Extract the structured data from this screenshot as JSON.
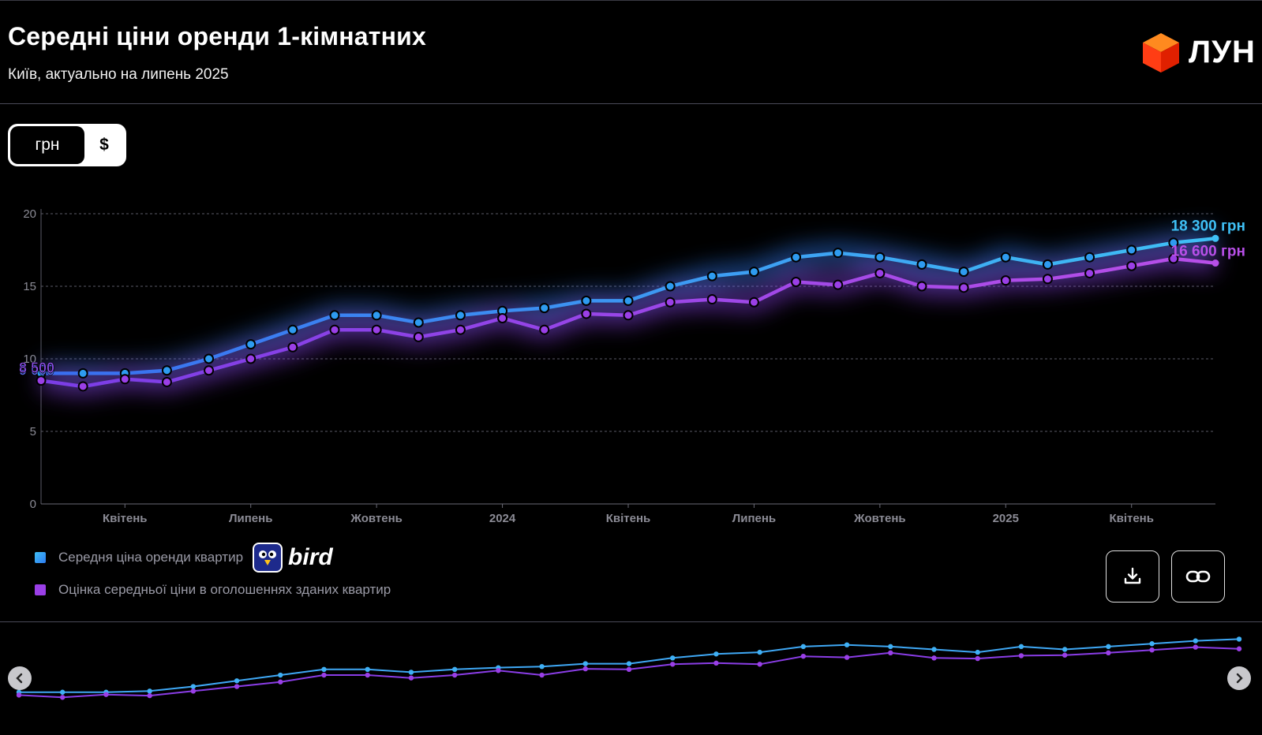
{
  "header": {
    "title": "Середні ціни оренди 1-кімнатних",
    "subtitle": "Київ, актуально на липень 2025",
    "logo_text": "ЛУН"
  },
  "currency_toggle": {
    "options": [
      "грн",
      "$"
    ],
    "selected": "грн"
  },
  "colors": {
    "series1": "#2e9bf0",
    "series1_light": "#3fc0f5",
    "series2": "#9a3fe6",
    "series2_light": "#b84fe8",
    "grid": "#5a5a66"
  },
  "chart_data": {
    "type": "line",
    "ylim": [
      0,
      20
    ],
    "yticks": [
      0,
      5,
      10,
      15,
      20
    ],
    "grid": true,
    "x_labels": [
      {
        "index": 2,
        "label": "Квітень"
      },
      {
        "index": 5,
        "label": "Липень"
      },
      {
        "index": 8,
        "label": "Жовтень"
      },
      {
        "index": 11,
        "label": "2024"
      },
      {
        "index": 14,
        "label": "Квітень"
      },
      {
        "index": 17,
        "label": "Липень"
      },
      {
        "index": 20,
        "label": "Жовтень"
      },
      {
        "index": 23,
        "label": "2025"
      },
      {
        "index": 26,
        "label": "Квітень"
      }
    ],
    "series": [
      {
        "name": "Середня ціна оренди квартир",
        "start_label": "9 000",
        "end_label": "18 300 грн",
        "values": [
          9.0,
          9.0,
          9.0,
          9.2,
          10.0,
          11.0,
          12.0,
          13.0,
          13.0,
          12.5,
          13.0,
          13.3,
          13.5,
          14.0,
          14.0,
          15.0,
          15.7,
          16.0,
          17.0,
          17.3,
          17.0,
          16.5,
          16.0,
          17.0,
          16.5,
          17.0,
          17.5,
          18.0,
          18.3
        ]
      },
      {
        "name": "Оцінка середньої ціни в оголошеннях зданих квартир",
        "start_label": "8 500",
        "end_label": "16 600 грн",
        "values": [
          8.5,
          8.1,
          8.6,
          8.4,
          9.2,
          10.0,
          10.8,
          12.0,
          12.0,
          11.5,
          12.0,
          12.8,
          12.0,
          13.1,
          13.0,
          13.9,
          14.1,
          13.9,
          15.3,
          15.1,
          15.9,
          15.0,
          14.9,
          15.4,
          15.5,
          15.9,
          16.4,
          16.9,
          16.6
        ]
      }
    ]
  },
  "legend": {
    "items": [
      {
        "label": "Середня ціна оренди квартир",
        "partner": "bird"
      },
      {
        "label": "Оцінка середньої ціни в оголошеннях зданих квартир"
      }
    ]
  },
  "actions": {
    "download_icon": "download-icon",
    "link_icon": "link-icon"
  }
}
